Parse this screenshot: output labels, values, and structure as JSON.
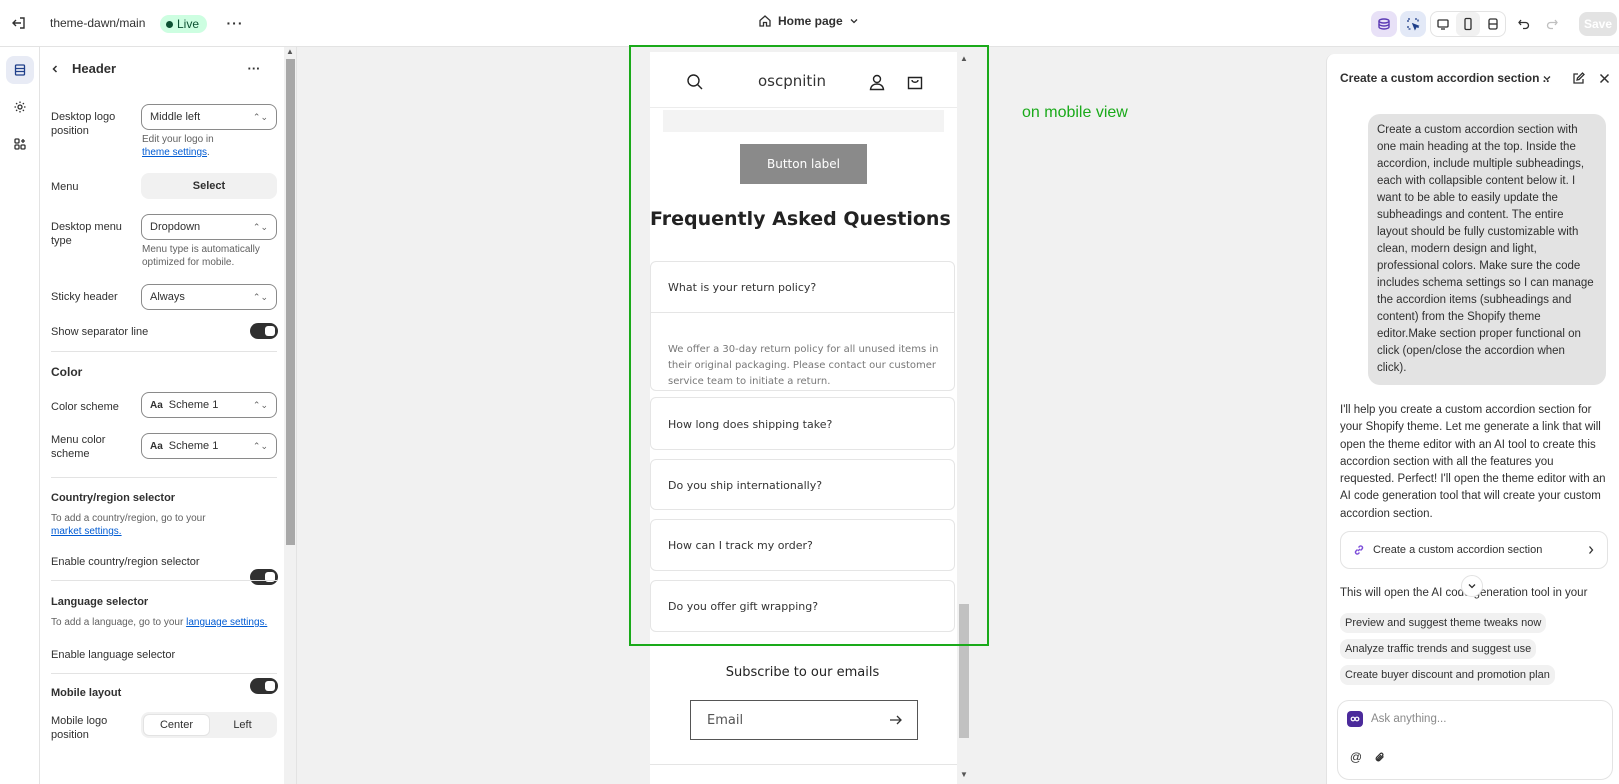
{
  "topbar": {
    "theme_name": "theme-dawn/main",
    "live_label": "Live",
    "page_label": "Home page",
    "save_label": "Save"
  },
  "panel": {
    "title": "Header",
    "desktop_logo_position": {
      "label": "Desktop logo position",
      "value": "Middle left",
      "help": "Edit your logo in",
      "help_link": "theme settings",
      "help_end": "."
    },
    "menu": {
      "label": "Menu",
      "button": "Select"
    },
    "desktop_menu_type": {
      "label": "Desktop menu type",
      "value": "Dropdown",
      "help": "Menu type is automatically optimized for mobile."
    },
    "sticky_header": {
      "label": "Sticky header",
      "value": "Always"
    },
    "separator": {
      "label": "Show separator line"
    },
    "color": {
      "title": "Color",
      "scheme_label": "Color scheme",
      "scheme_value": "Scheme 1",
      "menu_scheme_label": "Menu color scheme",
      "menu_scheme_value": "Scheme 1",
      "aa": "Aa"
    },
    "country": {
      "title": "Country/region selector",
      "help": "To add a country/region, go to your",
      "link": "market settings.",
      "toggle_label": "Enable country/region selector"
    },
    "language": {
      "title": "Language selector",
      "help": "To add a language, go to your",
      "link": "language settings.",
      "toggle_label": "Enable language selector"
    },
    "mobile": {
      "title": "Mobile layout",
      "logo_label": "Mobile logo position",
      "option_center": "Center",
      "option_left": "Left"
    }
  },
  "preview": {
    "store_name": "oscpnitin",
    "button_label": "Button label",
    "faq_heading": "Frequently Asked Questions",
    "faq": [
      {
        "q": "What is your return policy?",
        "a": "We offer a 30-day return policy for all unused items in their original packaging. Please contact our customer service team to initiate a return."
      },
      {
        "q": "How long does shipping take?"
      },
      {
        "q": "Do you ship internationally?"
      },
      {
        "q": "How can I track my order?"
      },
      {
        "q": "Do you offer gift wrapping?"
      }
    ],
    "subscribe_title": "Subscribe to our emails",
    "email_placeholder": "Email",
    "annotation": "on mobile view",
    "annotation_color": "#1aaa1a"
  },
  "assistant": {
    "title": "Create a custom accordion section ...",
    "user_message": "Create a custom accordion section with one main heading at the top. Inside the accordion, include multiple subheadings, each with collapsible content below it. I want to be able to easily update the subheadings and content. The entire layout should be fully customizable with clean, modern design and light, professional colors. Make sure the code includes schema settings so I can manage the accordion items (subheadings and content) from the Shopify theme editor.Make section proper functional on click (open/close the accordion when click).",
    "reply": "I'll help you create a custom accordion section for your Shopify theme. Let me generate a link that will open the theme editor with an AI tool to create this accordion section with all the features you requested. Perfect! I'll open the theme editor with an AI code generation tool that will create your custom accordion section.",
    "link_card": "Create a custom accordion section",
    "partial_text": "This will open the AI code generation tool in your",
    "suggestions": [
      "Preview and suggest theme tweaks now",
      "Analyze traffic trends and suggest use",
      "Create buyer discount and promotion plan"
    ],
    "input_placeholder": "Ask anything..."
  }
}
